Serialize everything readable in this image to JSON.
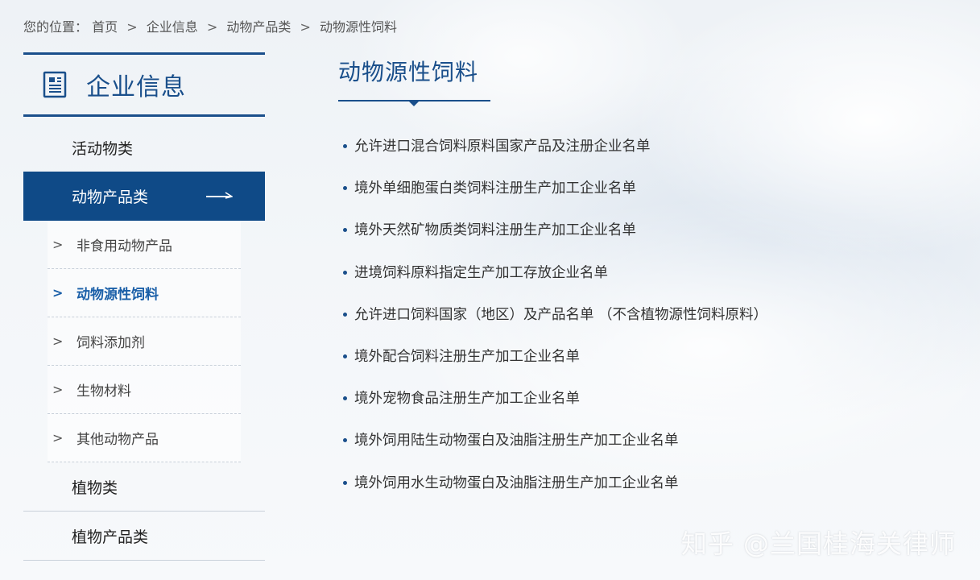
{
  "breadcrumb": {
    "prefix": "您的位置：",
    "items": [
      "首页",
      "企业信息",
      "动物产品类",
      "动物源性饲料"
    ],
    "separator": ">"
  },
  "sidebar": {
    "icon": "document-icon",
    "title": "企业信息",
    "categories_top": [
      {
        "label": "活动物类"
      },
      {
        "label": "动物产品类",
        "active": true,
        "icon": "arrow-right-icon"
      }
    ],
    "subitems": [
      {
        "label": "非食用动物产品"
      },
      {
        "label": "动物源性饲料",
        "active": true
      },
      {
        "label": "饲料添加剂"
      },
      {
        "label": "生物材料"
      },
      {
        "label": "其他动物产品"
      }
    ],
    "categories_bottom": [
      {
        "label": "植物类"
      },
      {
        "label": "植物产品类"
      }
    ]
  },
  "main": {
    "title": "动物源性饲料",
    "links": [
      "允许进口混合饲料原料国家产品及注册企业名单",
      "境外单细胞蛋白类饲料注册生产加工企业名单",
      "境外天然矿物质类饲料注册生产加工企业名单",
      "进境饲料原料指定生产加工存放企业名单",
      "允许进口饲料国家（地区）及产品名单 （不含植物源性饲料原料）",
      "境外配合饲料注册生产加工企业名单",
      "境外宠物食品注册生产加工企业名单",
      "境外饲用陆生动物蛋白及油脂注册生产加工企业名单",
      "境外饲用水生动物蛋白及油脂注册生产加工企业名单"
    ]
  },
  "watermark": "知乎 @兰国桂海关律师",
  "colors": {
    "brand": "#1a4f8b",
    "active_bg": "#0f4a87",
    "active_sub": "#1a5fa8"
  }
}
